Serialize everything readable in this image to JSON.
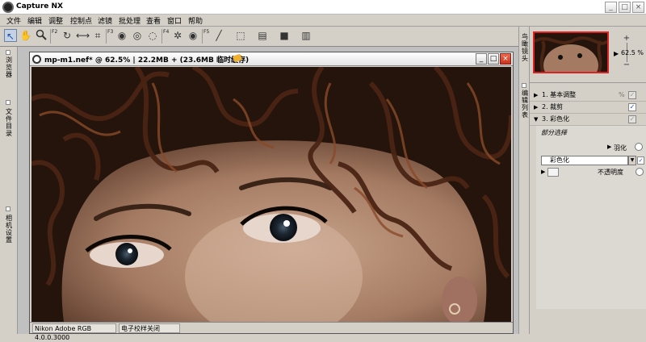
{
  "window": {
    "title": "Capture NX",
    "minimize": "_",
    "maximize": "□",
    "close": "×"
  },
  "menu": [
    "文件",
    "编辑",
    "调整",
    "控制点",
    "滤镜",
    "批处理",
    "查看",
    "窗口",
    "帮助"
  ],
  "toolbar": {
    "badges": [
      "F2",
      "F3",
      "F4",
      "F5"
    ],
    "tools": [
      {
        "name": "direct-select-icon",
        "glyph": "↖"
      },
      {
        "name": "hand-icon",
        "glyph": "✋"
      },
      {
        "name": "zoom-icon",
        "glyph": "🔍"
      },
      {
        "name": "rotate-icon",
        "glyph": "↻"
      },
      {
        "name": "straighten-icon",
        "glyph": "⟷"
      },
      {
        "name": "crop-icon",
        "glyph": "⌗"
      },
      {
        "name": "control-point-black-icon",
        "glyph": "◉"
      },
      {
        "name": "control-point-white-icon",
        "glyph": "◎"
      },
      {
        "name": "control-point-neutral-icon",
        "glyph": "◌"
      },
      {
        "name": "red-eye-icon",
        "glyph": "✲"
      },
      {
        "name": "eye-icon",
        "glyph": "◉"
      },
      {
        "name": "brush-icon",
        "glyph": "╱"
      },
      {
        "name": "marquee-icon",
        "glyph": "⬚"
      },
      {
        "name": "gradient-icon",
        "glyph": "▤"
      },
      {
        "name": "fill-icon",
        "glyph": "■"
      },
      {
        "name": "filter-icon",
        "glyph": "▥"
      }
    ]
  },
  "left_tabs": {
    "browser": "浏览器",
    "file_dir": "文件目录",
    "camera": "相机设置"
  },
  "document": {
    "filename": "mp-m1.nef*",
    "zoom": "@ 62.5%",
    "size": "22.2MB",
    "plus": "+",
    "cache": "(23.6MB 临时缓存)",
    "minimize": "_",
    "maximize": "□",
    "close": "×"
  },
  "status": {
    "profile": "Nikon Adobe RGB 4.0.0.3000",
    "softproof": "电子校样关闭"
  },
  "right_tabs": {
    "birdseye": "鸟瞰镜头",
    "edit_list": "编辑列表"
  },
  "zoom_panel": {
    "zoom_in": "+",
    "zoom_out": "−",
    "level": "62.5 %",
    "pointer": "▶"
  },
  "edit_list": {
    "steps": [
      {
        "label": "1. 基本调整",
        "checked": false
      },
      {
        "label": "2. 裁剪",
        "checked": true
      },
      {
        "label": "3. 彩色化",
        "checked": false
      }
    ],
    "selection_heading": "部分选择",
    "feather": "羽化",
    "color_effect": "彩色化",
    "opacity": "不透明度"
  },
  "colors": {
    "chrome": "#d4d0c8",
    "birdseye_border": "#dd2222",
    "close_button": "#d0402a"
  }
}
